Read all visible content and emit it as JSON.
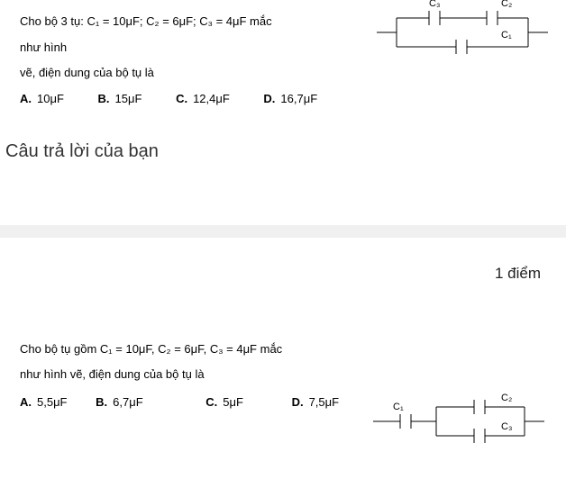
{
  "q1": {
    "text_line1": "Cho bộ 3 tụ: C₁ = 10μF; C₂ = 6μF; C₃ = 4μF mắc như hình",
    "text_line2": "vẽ, điện dung của bộ tụ là",
    "opts": {
      "a_lbl": "A.",
      "a_val": "10μF",
      "b_lbl": "B.",
      "b_val": "15μF",
      "c_lbl": "C.",
      "c_val": "12,4μF",
      "d_lbl": "D.",
      "d_val": "16,7μF"
    },
    "circuit_labels": {
      "c1": "C₁",
      "c2": "C₂",
      "c3": "C₃"
    }
  },
  "answer_prompt": "Câu trả lời của bạn",
  "points": "1 điểm",
  "q2": {
    "text_line1": "Cho bộ tụ gồm  C₁ = 10μF, C₂ = 6μF, C₃ = 4μF mắc",
    "text_line2": "như hình vẽ, điện dung của bộ tụ là",
    "opts": {
      "a_lbl": "A.",
      "a_val": "5,5μF",
      "b_lbl": "B.",
      "b_val": "6,7μF",
      "c_lbl": "C.",
      "c_val": "5μF",
      "d_lbl": "D.",
      "d_val": "7,5μF"
    },
    "circuit_labels": {
      "c1": "C₁",
      "c2": "C₂",
      "c3": "C₃"
    }
  }
}
